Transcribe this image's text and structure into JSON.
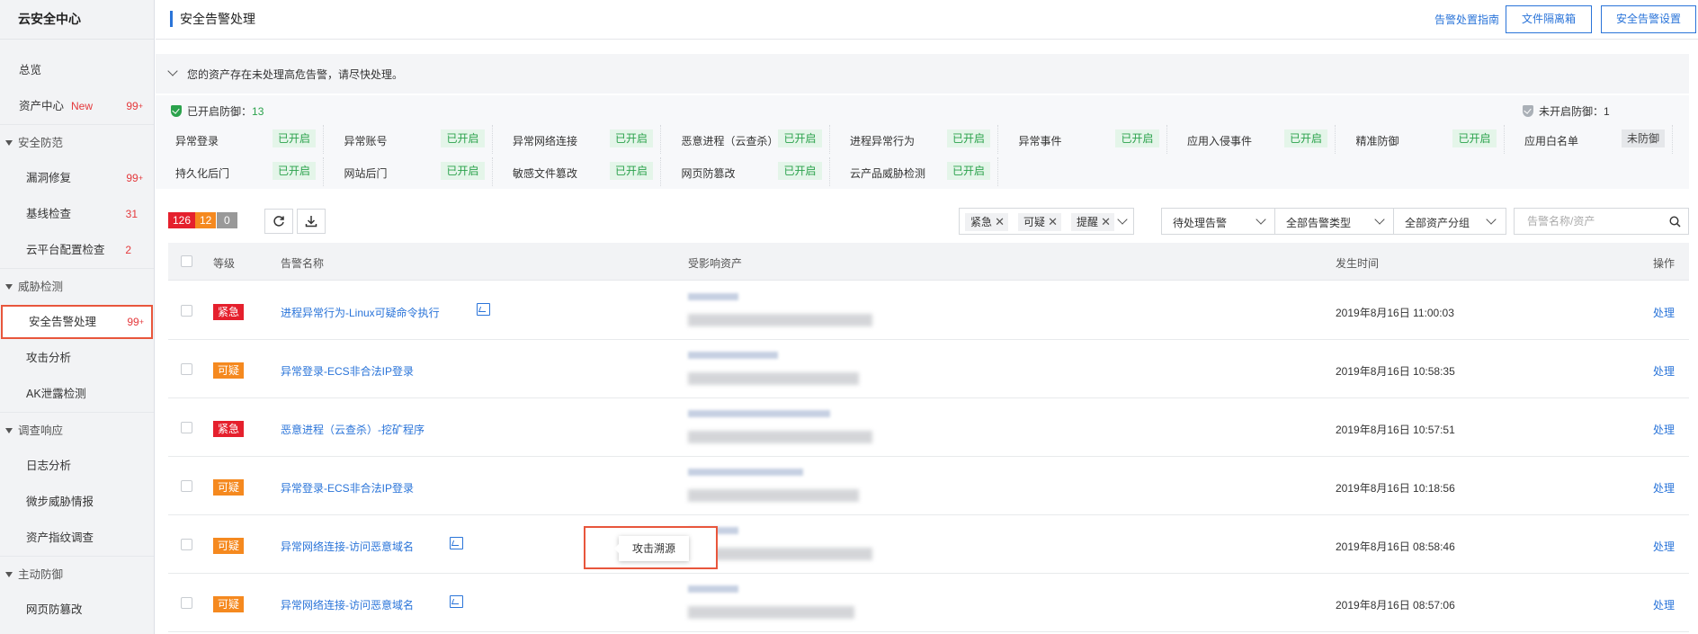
{
  "sidebar": {
    "title": "云安全中心",
    "overview": "总览",
    "asset_center": {
      "label": "资产中心",
      "new": "New",
      "count": "99"
    },
    "groups": {
      "defense": "安全防范",
      "threat": "威胁检测",
      "response": "调查响应",
      "active": "主动防御"
    },
    "items": {
      "vuln": {
        "label": "漏洞修复",
        "count": "99"
      },
      "baseline": {
        "label": "基线检查",
        "count": "31"
      },
      "cloud_config": {
        "label": "云平台配置检查",
        "count": "2"
      },
      "alert": {
        "label": "安全告警处理",
        "count": "99"
      },
      "attack": {
        "label": "攻击分析"
      },
      "ak": {
        "label": "AK泄露检测"
      },
      "log": {
        "label": "日志分析"
      },
      "intel": {
        "label": "微步威胁情报"
      },
      "fingerprint": {
        "label": "资产指纹调查"
      },
      "tamper": {
        "label": "网页防篡改"
      }
    }
  },
  "header": {
    "title": "安全告警处理",
    "guide_link": "告警处置指南",
    "quarantine_button": "文件隔离箱",
    "settings_button": "安全告警设置"
  },
  "notice": "您的资产存在未处理高危告警，请尽快处理。",
  "protection": {
    "enabled_label": "已开启防御：",
    "enabled_count": "13",
    "disabled_label": "未开启防御：",
    "disabled_count": "1",
    "items": [
      {
        "name": "异常登录",
        "status": "已开启",
        "on": true
      },
      {
        "name": "异常账号",
        "status": "已开启",
        "on": true
      },
      {
        "name": "异常网络连接",
        "status": "已开启",
        "on": true
      },
      {
        "name": "恶意进程（云查杀）",
        "status": "已开启",
        "on": true
      },
      {
        "name": "进程异常行为",
        "status": "已开启",
        "on": true
      },
      {
        "name": "异常事件",
        "status": "已开启",
        "on": true
      },
      {
        "name": "应用入侵事件",
        "status": "已开启",
        "on": true
      },
      {
        "name": "精准防御",
        "status": "已开启",
        "on": true
      },
      {
        "name": "应用白名单",
        "status": "未防御",
        "on": false
      },
      {
        "name": "持久化后门",
        "status": "已开启",
        "on": true
      },
      {
        "name": "网站后门",
        "status": "已开启",
        "on": true
      },
      {
        "name": "敏感文件篡改",
        "status": "已开启",
        "on": true
      },
      {
        "name": "网页防篡改",
        "status": "已开启",
        "on": true
      },
      {
        "name": "云产品威胁检测",
        "status": "已开启",
        "on": true
      }
    ]
  },
  "toolbar": {
    "counts": [
      {
        "value": "126",
        "color": "#e5202d"
      },
      {
        "value": "12",
        "color": "#f5891f"
      },
      {
        "value": "0",
        "color": "#999999"
      }
    ],
    "tags": [
      "紧急",
      "可疑",
      "提醒"
    ],
    "status_select": "待处理告警",
    "type_select": "全部告警类型",
    "group_select": "全部资产分组",
    "search_placeholder": "告警名称/资产"
  },
  "table": {
    "headers": {
      "level": "等级",
      "name": "告警名称",
      "asset": "受影响资产",
      "time": "发生时间",
      "op": "操作"
    },
    "rows": [
      {
        "level": "紧急",
        "type": "urgent",
        "name": "进程异常行为-Linux可疑命令执行",
        "icon": true,
        "time": "2019年8月16日 11:00:03",
        "op": "处理"
      },
      {
        "level": "可疑",
        "type": "suspect",
        "name": "异常登录-ECS非合法IP登录",
        "icon": false,
        "time": "2019年8月16日 10:58:35",
        "op": "处理"
      },
      {
        "level": "紧急",
        "type": "urgent",
        "name": "恶意进程（云查杀）-挖矿程序",
        "icon": false,
        "time": "2019年8月16日 10:57:51",
        "op": "处理"
      },
      {
        "level": "可疑",
        "type": "suspect",
        "name": "异常登录-ECS非合法IP登录",
        "icon": false,
        "time": "2019年8月16日 10:18:56",
        "op": "处理"
      },
      {
        "level": "可疑",
        "type": "suspect",
        "name": "异常网络连接-访问恶意域名",
        "icon": true,
        "time": "2019年8月16日 08:58:46",
        "op": "处理"
      },
      {
        "level": "可疑",
        "type": "suspect",
        "name": "异常网络连接-访问恶意域名",
        "icon": true,
        "time": "2019年8月16日 08:57:06",
        "op": "处理"
      }
    ]
  },
  "tooltip": "攻击溯源"
}
